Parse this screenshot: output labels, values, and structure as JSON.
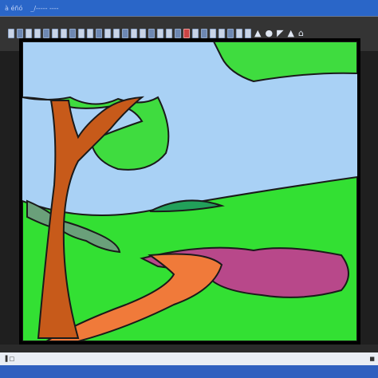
{
  "window": {
    "title_left": "à éñó",
    "title_right": "_/‐‐‐‐‐ ‐‐‐‐"
  },
  "toolbar": {
    "tools": [
      "brush",
      "pencil",
      "eraser",
      "fill",
      "picker",
      "line",
      "rect",
      "ellipse",
      "text",
      "select",
      "move",
      "zoom",
      "undo",
      "redo",
      "rotate",
      "flip",
      "crop",
      "grid",
      "layers",
      "palette",
      "cut",
      "copy",
      "paste",
      "open",
      "save",
      "print",
      "close",
      "settings"
    ],
    "glyph_icons": [
      "▲",
      "●",
      "◤",
      "▲",
      "⌂"
    ]
  },
  "colors": {
    "sky": "#a9d1f5",
    "grass": "#33e033",
    "foliage": "#3fdc3f",
    "trunk": "#c75a1a",
    "path_orange": "#f07a3a",
    "path_purple": "#b8488a",
    "outline": "#1a1a1a",
    "hill_dark": "#22a05a",
    "bush": "#6aa07a"
  },
  "statusbar": {
    "left": "▐ □",
    "right": "■"
  }
}
